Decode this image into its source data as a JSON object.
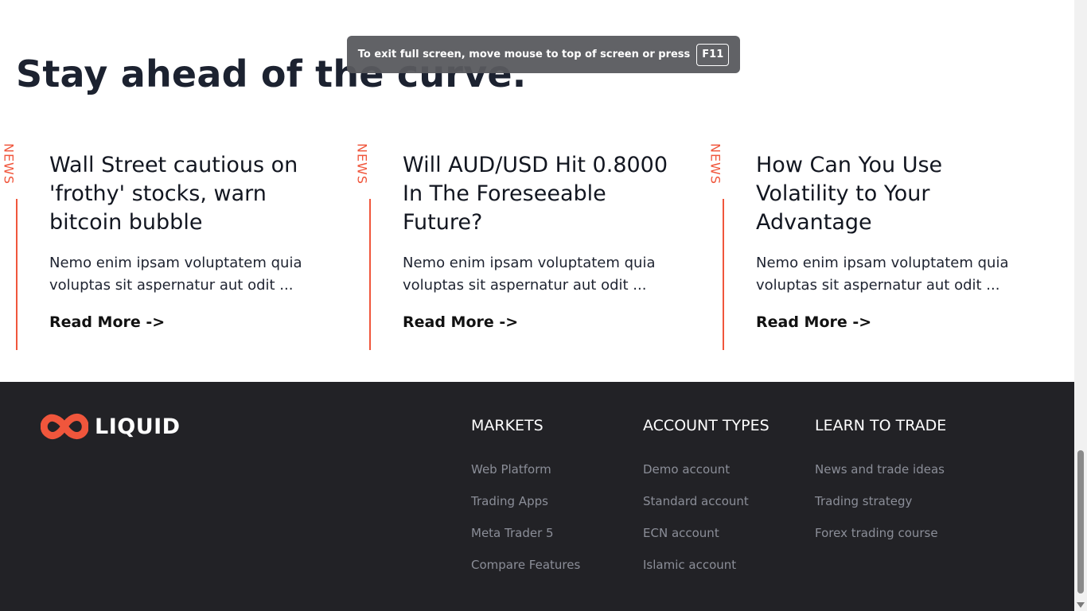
{
  "section": {
    "title": "Stay ahead of the curve."
  },
  "fullscreen_notice": {
    "message": "To exit full screen, move mouse to top of screen or press",
    "key": "F11"
  },
  "cards": [
    {
      "tag": "NEWS",
      "title": "Wall Street cautious on 'frothy' stocks, warn bitcoin bubble",
      "excerpt": "Nemo enim ipsam voluptatem quia voluptas sit aspernatur aut odit ...",
      "link": "Read More ->"
    },
    {
      "tag": "NEWS",
      "title": "Will AUD/USD Hit 0.8000 In The Foreseeable Future?",
      "excerpt": "Nemo enim ipsam voluptatem quia voluptas sit aspernatur aut odit ...",
      "link": "Read More ->"
    },
    {
      "tag": "NEWS",
      "title": "How Can You Use Volatility to Your Advantage",
      "excerpt": "Nemo enim ipsam voluptatem quia voluptas sit aspernatur aut odit ...",
      "link": "Read More ->"
    }
  ],
  "footer": {
    "logo_text": "LIQUID",
    "columns": [
      {
        "heading": "MARKETS",
        "links": [
          "Web Platform",
          "Trading Apps",
          "Meta Trader 5",
          "Compare Features"
        ]
      },
      {
        "heading": "ACCOUNT TYPES",
        "links": [
          "Demo account",
          "Standard account",
          "ECN account",
          "Islamic account"
        ]
      },
      {
        "heading": "LEARN TO TRADE",
        "links": [
          "News and trade ideas",
          "Trading strategy",
          "Forex trading course"
        ]
      }
    ]
  },
  "colors": {
    "accent": "#f0563c",
    "footer_bg": "#222226",
    "footer_link": "#8b8e98",
    "heading": "#1c2230"
  },
  "icons": {
    "logo": "infinity-logo-icon",
    "scroll_down": "scroll-down-arrow-icon"
  }
}
